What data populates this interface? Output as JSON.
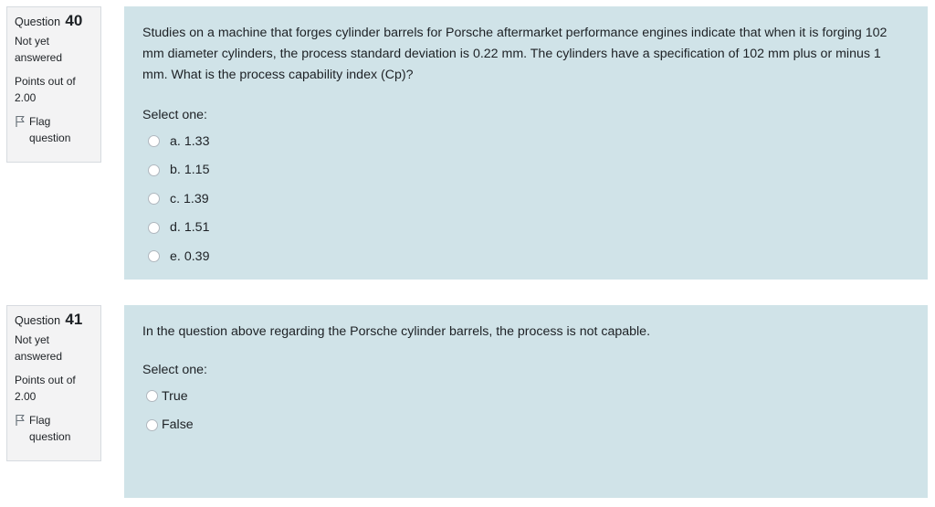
{
  "questions": [
    {
      "label": "Question",
      "number": "40",
      "state": "Not yet answered",
      "grade": "Points out of 2.00",
      "flag_label": "Flag question",
      "text": "Studies on a machine that forges cylinder barrels for Porsche aftermarket performance engines indicate that when it is forging 102 mm diameter cylinders, the process standard deviation is 0.22 mm. The cylinders have a specification of 102 mm plus or minus 1 mm. What is the process capability index (Cp)?",
      "prompt": "Select one:",
      "options": [
        {
          "num": "a.",
          "text": "1.33"
        },
        {
          "num": "b.",
          "text": "1.15"
        },
        {
          "num": "c.",
          "text": "1.39"
        },
        {
          "num": "d.",
          "text": "1.51"
        },
        {
          "num": "e.",
          "text": "0.39"
        }
      ]
    },
    {
      "label": "Question",
      "number": "41",
      "state": "Not yet answered",
      "grade": "Points out of 2.00",
      "flag_label": "Flag question",
      "text": "In the question above regarding the Porsche cylinder barrels, the process is not capable.",
      "prompt": "Select one:",
      "options": [
        {
          "text": "True"
        },
        {
          "text": "False"
        }
      ]
    }
  ],
  "colors": {
    "content_bg": "#d0e3e8",
    "info_bg": "#f3f3f4",
    "info_border": "#d7dbe0",
    "text": "#1d2125"
  }
}
